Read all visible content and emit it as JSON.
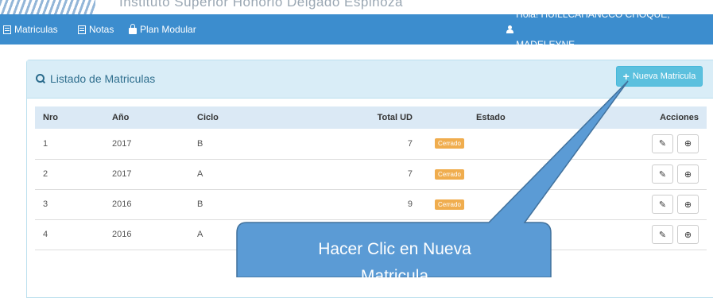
{
  "banner": {
    "text": "Instituto Superior Honorio Delgado Espinoza"
  },
  "navbar": {
    "items": [
      {
        "label": "Matriculas",
        "icon": "list-icon"
      },
      {
        "label": "Notas",
        "icon": "list-icon"
      },
      {
        "label": "Plan Modular",
        "icon": "lock-icon"
      }
    ],
    "user": {
      "label": "Hola! HUILLCAHANCCO CHOQUE, MADELEYNE",
      "icon": "user-icon"
    }
  },
  "panel": {
    "title": "Listado de Matriculas",
    "new_button": "Nueva Matricula"
  },
  "table": {
    "headers": [
      "Nro",
      "Año",
      "Ciclo",
      "Total UD",
      "Estado",
      "Acciones"
    ],
    "rows": [
      {
        "nro": "1",
        "anio": "2017",
        "ciclo": "B",
        "total": "7",
        "estado": "Cerrado"
      },
      {
        "nro": "2",
        "anio": "2017",
        "ciclo": "A",
        "total": "7",
        "estado": "Cerrado"
      },
      {
        "nro": "3",
        "anio": "2016",
        "ciclo": "B",
        "total": "9",
        "estado": "Cerrado"
      },
      {
        "nro": "4",
        "anio": "2016",
        "ciclo": "A",
        "total": "",
        "estado": ""
      }
    ]
  },
  "callout": {
    "line1": "Hacer Clic en Nueva",
    "line2": "Matricula"
  },
  "colors": {
    "navbar": "#3c8dce",
    "panel_head": "#d9edf7",
    "button": "#5bc0de",
    "badge": "#f0ad4e",
    "callout": "#5b9bd5"
  }
}
